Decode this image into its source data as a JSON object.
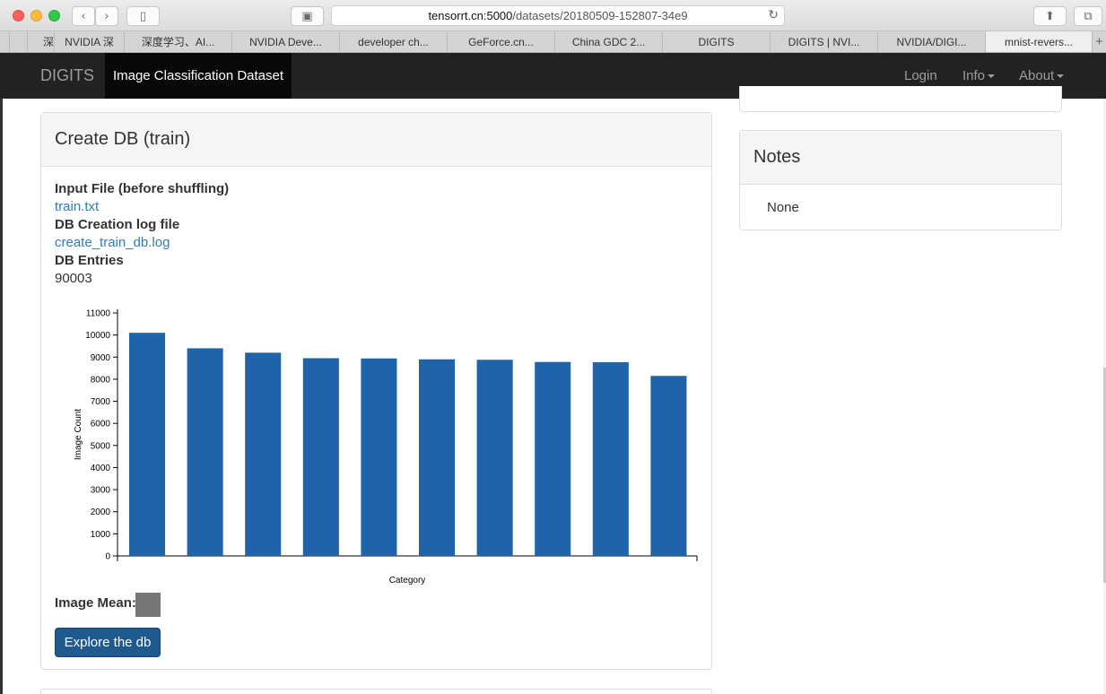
{
  "browser": {
    "url_host": "tensorrt.cn:5000",
    "url_path": "/datasets/20180509-152807-34e9",
    "tabs": [
      {
        "label": "深"
      },
      {
        "label": "NVIDIA 深"
      },
      {
        "label": "深度学习、AI..."
      },
      {
        "label": "NVIDIA Deve..."
      },
      {
        "label": "developer ch..."
      },
      {
        "label": "GeForce.cn..."
      },
      {
        "label": "China GDC 2..."
      },
      {
        "label": "DIGITS"
      },
      {
        "label": "DIGITS | NVI..."
      },
      {
        "label": "NVIDIA/DIGI..."
      },
      {
        "label": "mnist-revers..."
      }
    ],
    "new_tab": "+"
  },
  "navbar": {
    "brand": "DIGITS",
    "active": "Image Classification Dataset",
    "login": "Login",
    "info": "Info",
    "about": "About"
  },
  "train_panel": {
    "title": "Create DB (train)",
    "input_file_label": "Input File (before shuffling)",
    "input_file_link": "train.txt",
    "log_label": "DB Creation log file",
    "log_link": "create_train_db.log",
    "entries_label": "DB Entries",
    "entries_value": "90003",
    "mean_label": "Image Mean:",
    "explore_button": "Explore the db"
  },
  "notes_panel": {
    "title": "Notes",
    "body": "None"
  },
  "chart_data": {
    "type": "bar",
    "xlabel": "Category",
    "ylabel": "Image Count",
    "ylim": [
      0,
      11000
    ],
    "yticks": [
      0,
      1000,
      2000,
      3000,
      4000,
      5000,
      6000,
      7000,
      8000,
      9000,
      10000,
      11000
    ],
    "categories": [
      "",
      "",
      "",
      "",
      "",
      "",
      "",
      "",
      "",
      ""
    ],
    "values": [
      10100,
      9400,
      9200,
      8950,
      8940,
      8900,
      8880,
      8780,
      8770,
      8150
    ],
    "bar_color": "#1f63a8"
  }
}
